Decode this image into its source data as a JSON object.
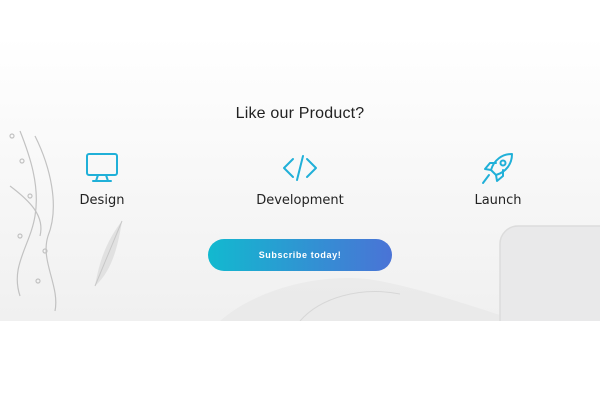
{
  "heading": "Like our Product?",
  "features": [
    {
      "label": "Design",
      "icon": "monitor-icon"
    },
    {
      "label": "Development",
      "icon": "code-icon"
    },
    {
      "label": "Launch",
      "icon": "rocket-icon"
    }
  ],
  "cta": {
    "label": "Subscribe today!"
  },
  "colors": {
    "accent": "#20b0d8",
    "gradient_start": "#12b9cf",
    "gradient_end": "#4a73d6",
    "text": "#222222"
  }
}
